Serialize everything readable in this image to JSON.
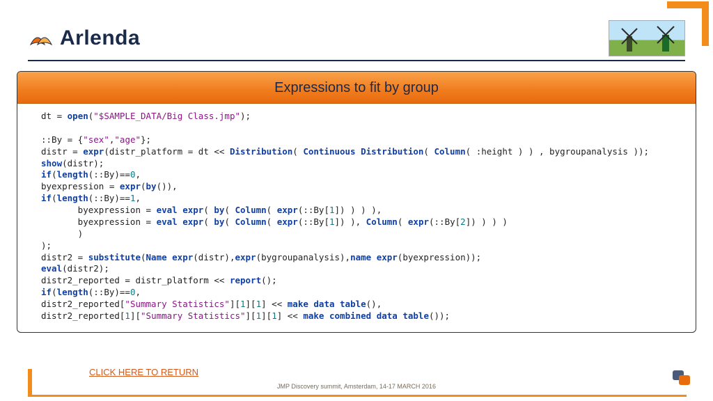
{
  "brand": {
    "name": "Arlenda"
  },
  "panel": {
    "title": "Expressions to fit by group"
  },
  "code": {
    "l01a": "dt = ",
    "l01_fn": "open",
    "l01b": "(",
    "l01_str": "\"$SAMPLE_DATA/Big Class.jmp\"",
    "l01c": ");",
    "l03a": "::By = {",
    "l03_s1": "\"sex\"",
    "l03b": ",",
    "l03_s2": "\"age\"",
    "l03c": "};",
    "l04a": "distr = ",
    "l04_fn1": "expr",
    "l04b": "(distr_platform = dt << ",
    "l04_fn2": "Distribution",
    "l04c": "( ",
    "l04_fn3": "Continuous Distribution",
    "l04d": "( ",
    "l04_fn4": "Column",
    "l04e": "( :height ) ) , bygroupanalysis ));",
    "l05_fn": "show",
    "l05b": "(distr);",
    "l06_fn": "if",
    "l06a": "(",
    "l06_fn2": "length",
    "l06b": "(::By)==",
    "l06_n": "0",
    "l06c": ",",
    "l07a": "byexpression = ",
    "l07_fn": "expr",
    "l07b": "(",
    "l07_fn2": "by",
    "l07c": "()),",
    "l08_fn": "if",
    "l08a": "(",
    "l08_fn2": "length",
    "l08b": "(::By)==",
    "l08_n": "1",
    "l08c": ",",
    "l09a": "       byexpression = ",
    "l09_fn1": "eval expr",
    "l09b": "( ",
    "l09_fn2": "by",
    "l09c": "( ",
    "l09_fn3": "Column",
    "l09d": "( ",
    "l09_fn4": "expr",
    "l09e": "(::By[",
    "l09_n": "1",
    "l09f": "]) ) ) ),",
    "l10a": "       byexpression = ",
    "l10_fn1": "eval expr",
    "l10b": "( ",
    "l10_fn2": "by",
    "l10c": "( ",
    "l10_fn3": "Column",
    "l10d": "( ",
    "l10_fn4": "expr",
    "l10e": "(::By[",
    "l10_n1": "1",
    "l10f": "]) ), ",
    "l10_fn5": "Column",
    "l10g": "( ",
    "l10_fn6": "expr",
    "l10h": "(::By[",
    "l10_n2": "2",
    "l10i": "]) ) ) )",
    "l11": "       )",
    "l12": ");",
    "l13a": "distr2 = ",
    "l13_fn1": "substitute",
    "l13b": "(",
    "l13_fn2": "Name expr",
    "l13c": "(distr),",
    "l13_fn3": "expr",
    "l13d": "(bygroupanalysis),",
    "l13_fn4": "name expr",
    "l13e": "(byexpression));",
    "l14_fn": "eval",
    "l14b": "(distr2);",
    "l15a": "distr2_reported = distr_platform << ",
    "l15_fn": "report",
    "l15b": "();",
    "l16_fn": "if",
    "l16a": "(",
    "l16_fn2": "length",
    "l16b": "(::By)==",
    "l16_n": "0",
    "l16c": ",",
    "l17a": "distr2_reported[",
    "l17_s": "\"Summary Statistics\"",
    "l17b": "][",
    "l17_n1": "1",
    "l17c": "][",
    "l17_n2": "1",
    "l17d": "] << ",
    "l17_fn": "make data table",
    "l17e": "(),",
    "l18a": "distr2_reported[",
    "l18_n0": "1",
    "l18b": "][",
    "l18_s": "\"Summary Statistics\"",
    "l18c": "][",
    "l18_n1": "1",
    "l18d": "][",
    "l18_n2": "1",
    "l18e": "] << ",
    "l18_fn": "make combined data table",
    "l18f": "());"
  },
  "link": {
    "return": "CLICK HERE TO RETURN"
  },
  "footer": {
    "note": "JMP Discovery summit, Amsterdam, 14-17 MARCH 2016"
  }
}
